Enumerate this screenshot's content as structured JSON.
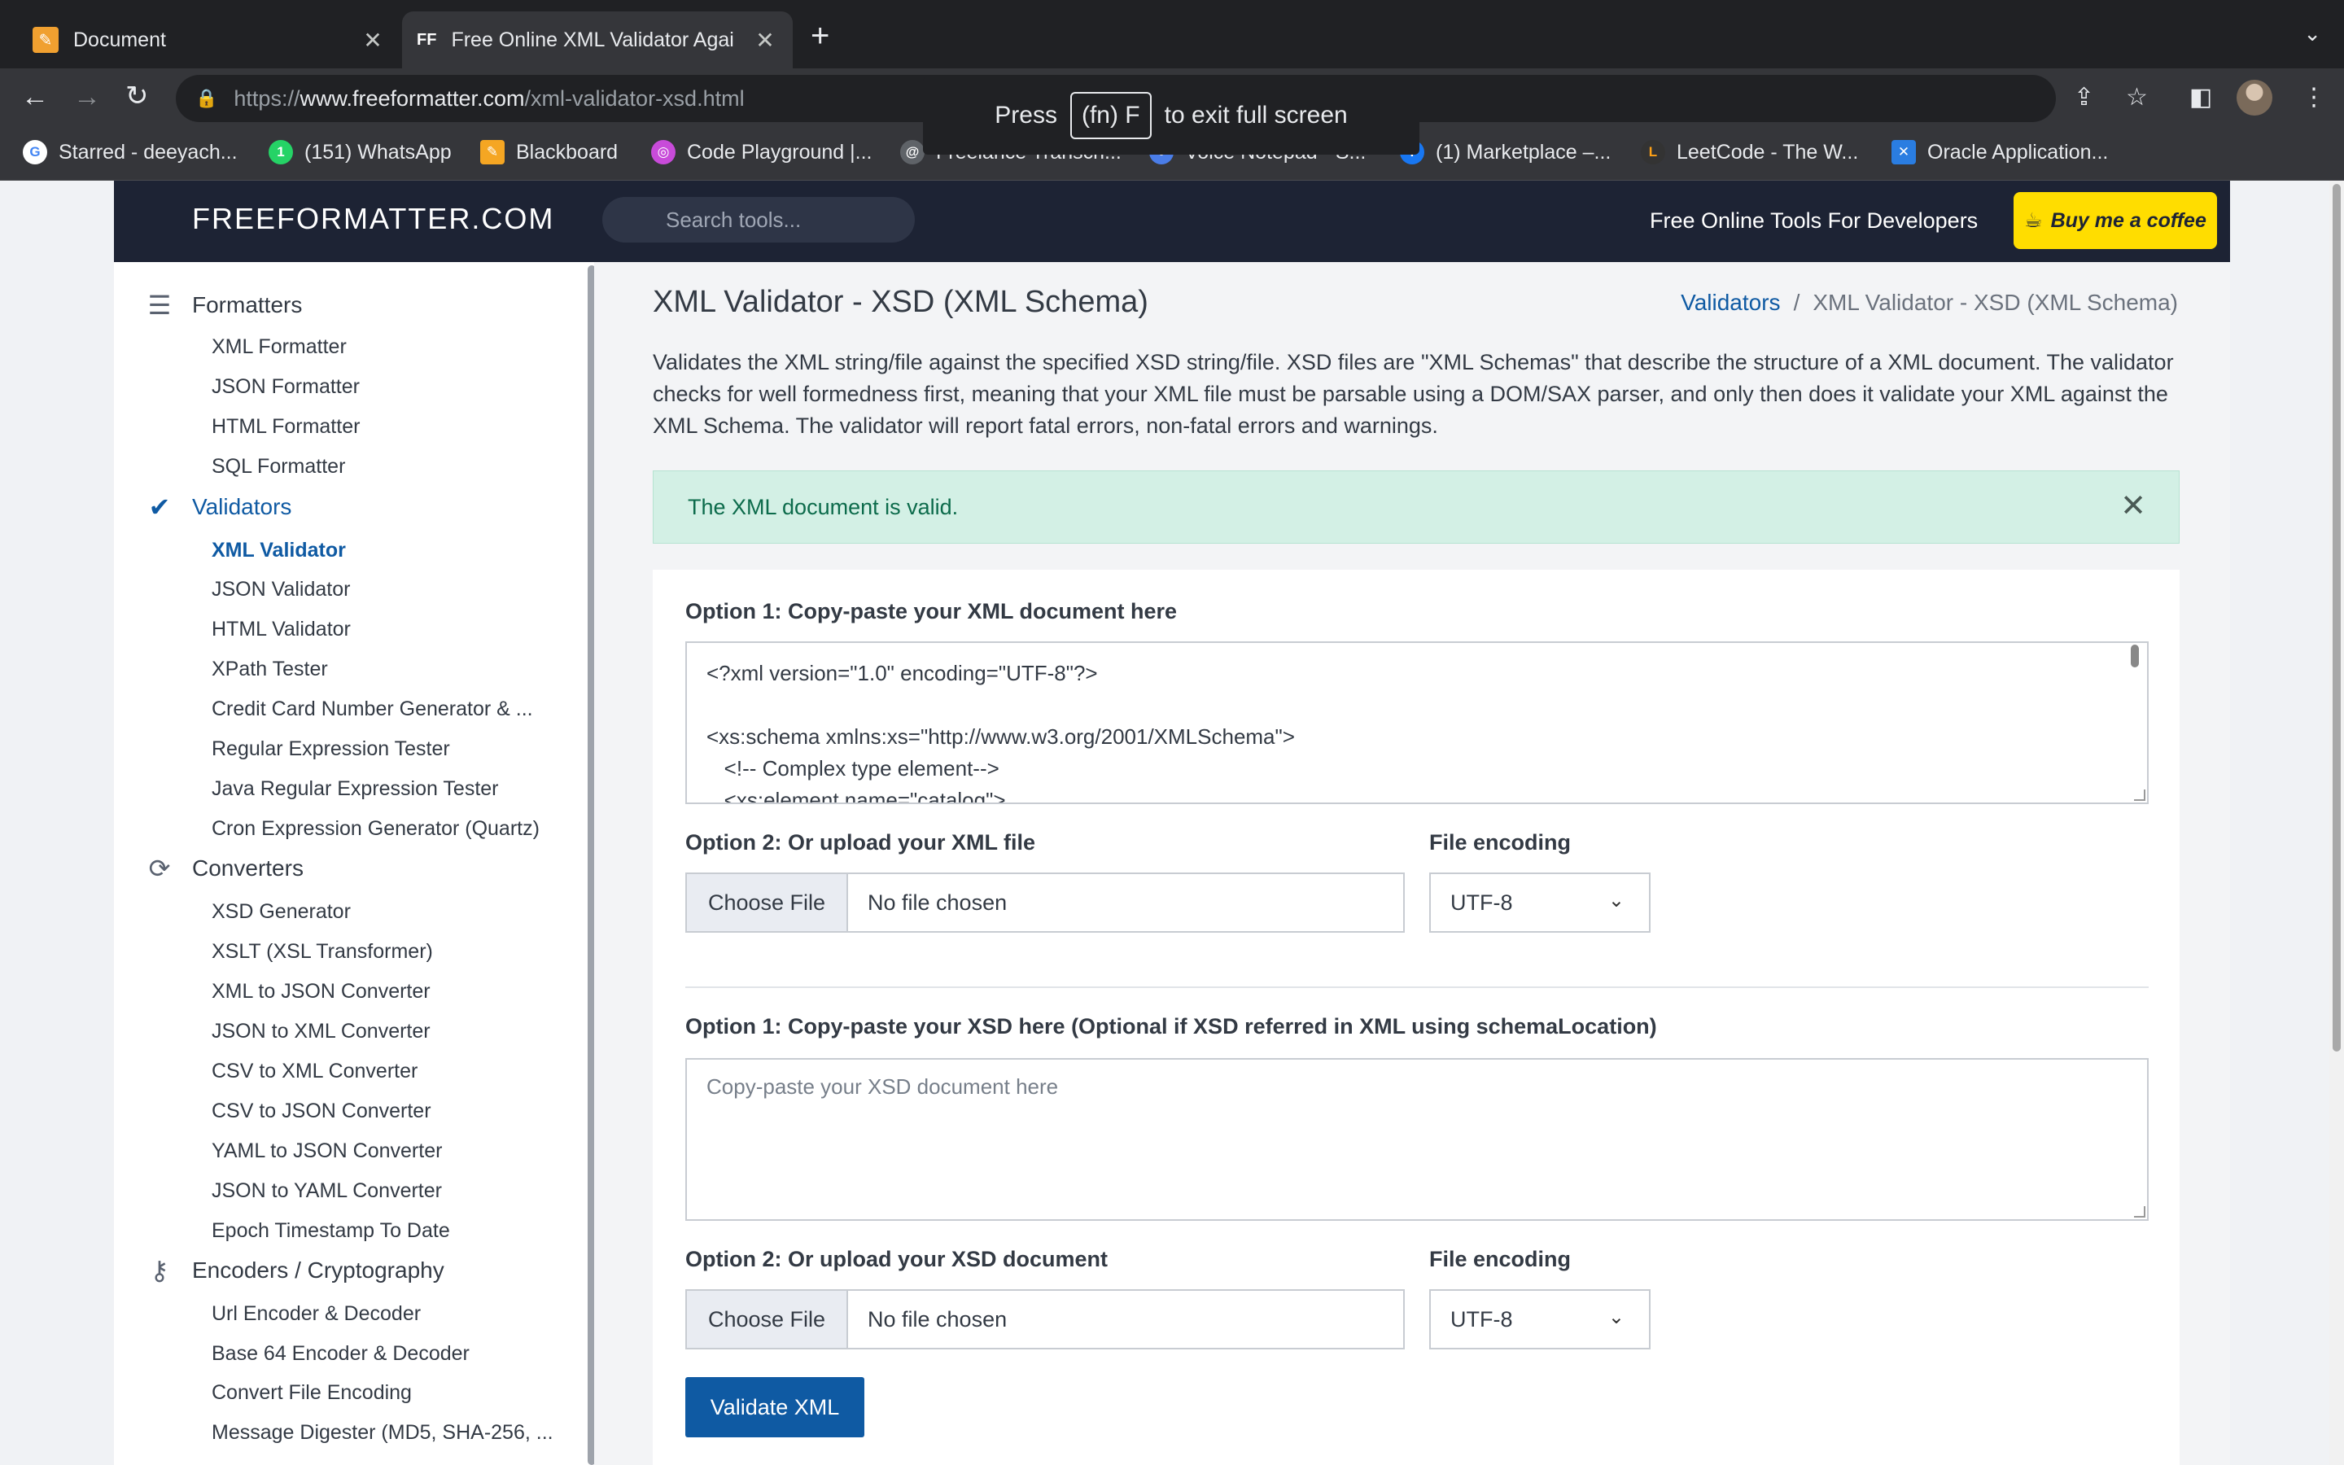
{
  "browser": {
    "tabs": [
      {
        "title": "Document",
        "icon": "document-tab-favicon"
      },
      {
        "title": "Free Online XML Validator Agai",
        "icon": "freeformatter-favicon",
        "favicon_text": "FF"
      }
    ],
    "new_tab": "+",
    "tab_menu": "⌄",
    "url_scheme": "https://",
    "url_host": "www.freeformatter.com",
    "url_path": "/xml-validator-xsd.html",
    "fullscreen": {
      "press": "Press",
      "key": "(fn) F",
      "suffix": "to exit full screen"
    },
    "bookmarks": [
      {
        "label": "Starred - deeyach...",
        "color": "#4285f4",
        "glyph": "G"
      },
      {
        "label": "(151) WhatsApp",
        "color": "#25d366",
        "glyph": "1"
      },
      {
        "label": "Blackboard",
        "color": "#f5a623",
        "glyph": "✎"
      },
      {
        "label": "Code Playground |...",
        "color": "#c84bd9",
        "glyph": "◎"
      },
      {
        "label": "Freelance Transcri...",
        "color": "#5f6368",
        "glyph": "@"
      },
      {
        "label": "Voice Notepad - S...",
        "color": "#4a7de8",
        "glyph": "🎙"
      },
      {
        "label": "(1) Marketplace –...",
        "color": "#1877f2",
        "glyph": "f"
      },
      {
        "label": "LeetCode - The W...",
        "color": "#ffa116",
        "glyph": "L"
      },
      {
        "label": "Oracle Application...",
        "color": "#2a7de1",
        "glyph": "✕"
      }
    ]
  },
  "site": {
    "logo": "FREEFORMATTER.COM",
    "search_placeholder": "Search tools...",
    "tagline": "Free Online Tools For Developers",
    "coffee": "Buy me a coffee"
  },
  "sidebar": {
    "formatters": {
      "title": "Formatters",
      "items": [
        "XML Formatter",
        "JSON Formatter",
        "HTML Formatter",
        "SQL Formatter"
      ]
    },
    "validators": {
      "title": "Validators",
      "items": [
        "XML Validator",
        "JSON Validator",
        "HTML Validator",
        "XPath Tester",
        "Credit Card Number Generator & ...",
        "Regular Expression Tester",
        "Java Regular Expression Tester",
        "Cron Expression Generator (Quartz)"
      ]
    },
    "converters": {
      "title": "Converters",
      "items": [
        "XSD Generator",
        "XSLT (XSL Transformer)",
        "XML to JSON Converter",
        "JSON to XML Converter",
        "CSV to XML Converter",
        "CSV to JSON Converter",
        "YAML to JSON Converter",
        "JSON to YAML Converter",
        "Epoch Timestamp To Date"
      ]
    },
    "encoders": {
      "title": "Encoders / Cryptography",
      "items": [
        "Url Encoder & Decoder",
        "Base 64 Encoder & Decoder",
        "Convert File Encoding",
        "Message Digester (MD5, SHA-256, ..."
      ]
    }
  },
  "main": {
    "title": "XML Validator - XSD (XML Schema)",
    "breadcrumb_link": "Validators",
    "breadcrumb_sep": "/",
    "breadcrumb_current": "XML Validator - XSD (XML Schema)",
    "description": "Validates the XML string/file against the specified XSD string/file. XSD files are \"XML Schemas\" that describe the structure of a XML document. The validator checks for well formedness first, meaning that your XML file must be parsable using a DOM/SAX parser, and only then does it validate your XML against the XML Schema. The validator will report fatal errors, non-fatal errors and warnings.",
    "alert": "The XML document is valid.",
    "xml_section": {
      "paste_label": "Option 1: Copy-paste your XML document here",
      "xml_content": "<?xml version=\"1.0\" encoding=\"UTF-8\"?>\n\n<xs:schema xmlns:xs=\"http://www.w3.org/2001/XMLSchema\">\n   <!-- Complex type element-->\n   <xs:element name=\"catalog\">",
      "upload_label": "Option 2: Or upload your XML file",
      "choose_file": "Choose File",
      "no_file": "No file chosen",
      "encoding_label": "File encoding",
      "encoding_value": "UTF-8"
    },
    "xsd_section": {
      "paste_label": "Option 1: Copy-paste your XSD here (Optional if XSD referred in XML using schemaLocation)",
      "placeholder": "Copy-paste your XSD document here",
      "upload_label": "Option 2: Or upload your XSD document",
      "choose_file": "Choose File",
      "no_file": "No file chosen",
      "encoding_label": "File encoding",
      "encoding_value": "UTF-8"
    },
    "validate_button": "Validate XML"
  }
}
